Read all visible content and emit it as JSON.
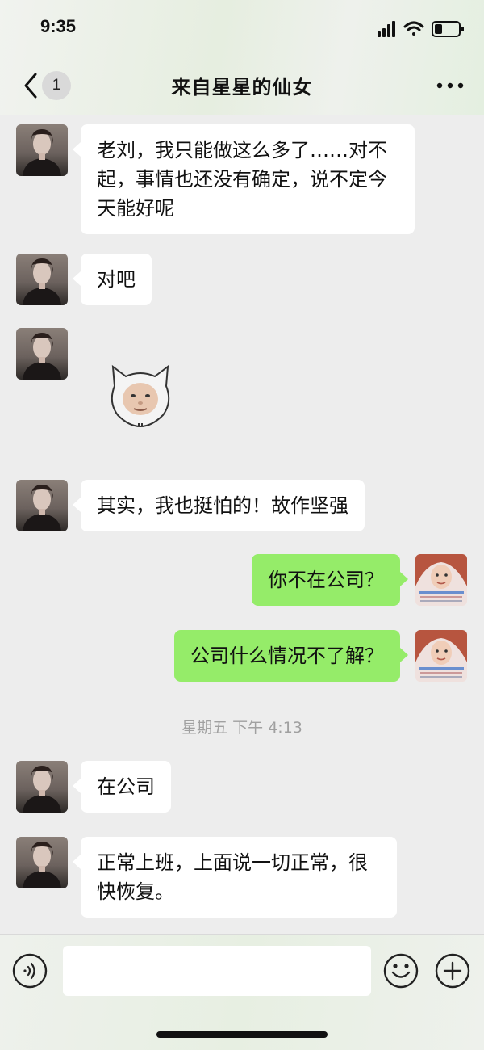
{
  "status_bar": {
    "time": "9:35"
  },
  "header": {
    "unread_count": "1",
    "title": "来自星星的仙女"
  },
  "messages": [
    {
      "text": "老刘，我只能做这么多了……对不起，事情也还没有确定，说不定今天能好呢"
    },
    {
      "text": "对吧"
    },
    {
      "sticker": "face-sticker"
    },
    {
      "text": "其实，我也挺怕的！故作坚强"
    },
    {
      "text": "你不在公司？"
    },
    {
      "text": "公司什么情况不了解？"
    },
    {
      "text": "在公司"
    },
    {
      "text": "正常上班，上面说一切正常，很快恢复。"
    }
  ],
  "time_divider": "星期五 下午 4:13",
  "colors": {
    "outgoing_bubble": "#95ec69",
    "incoming_bubble": "#ffffff",
    "background": "#ededed"
  }
}
